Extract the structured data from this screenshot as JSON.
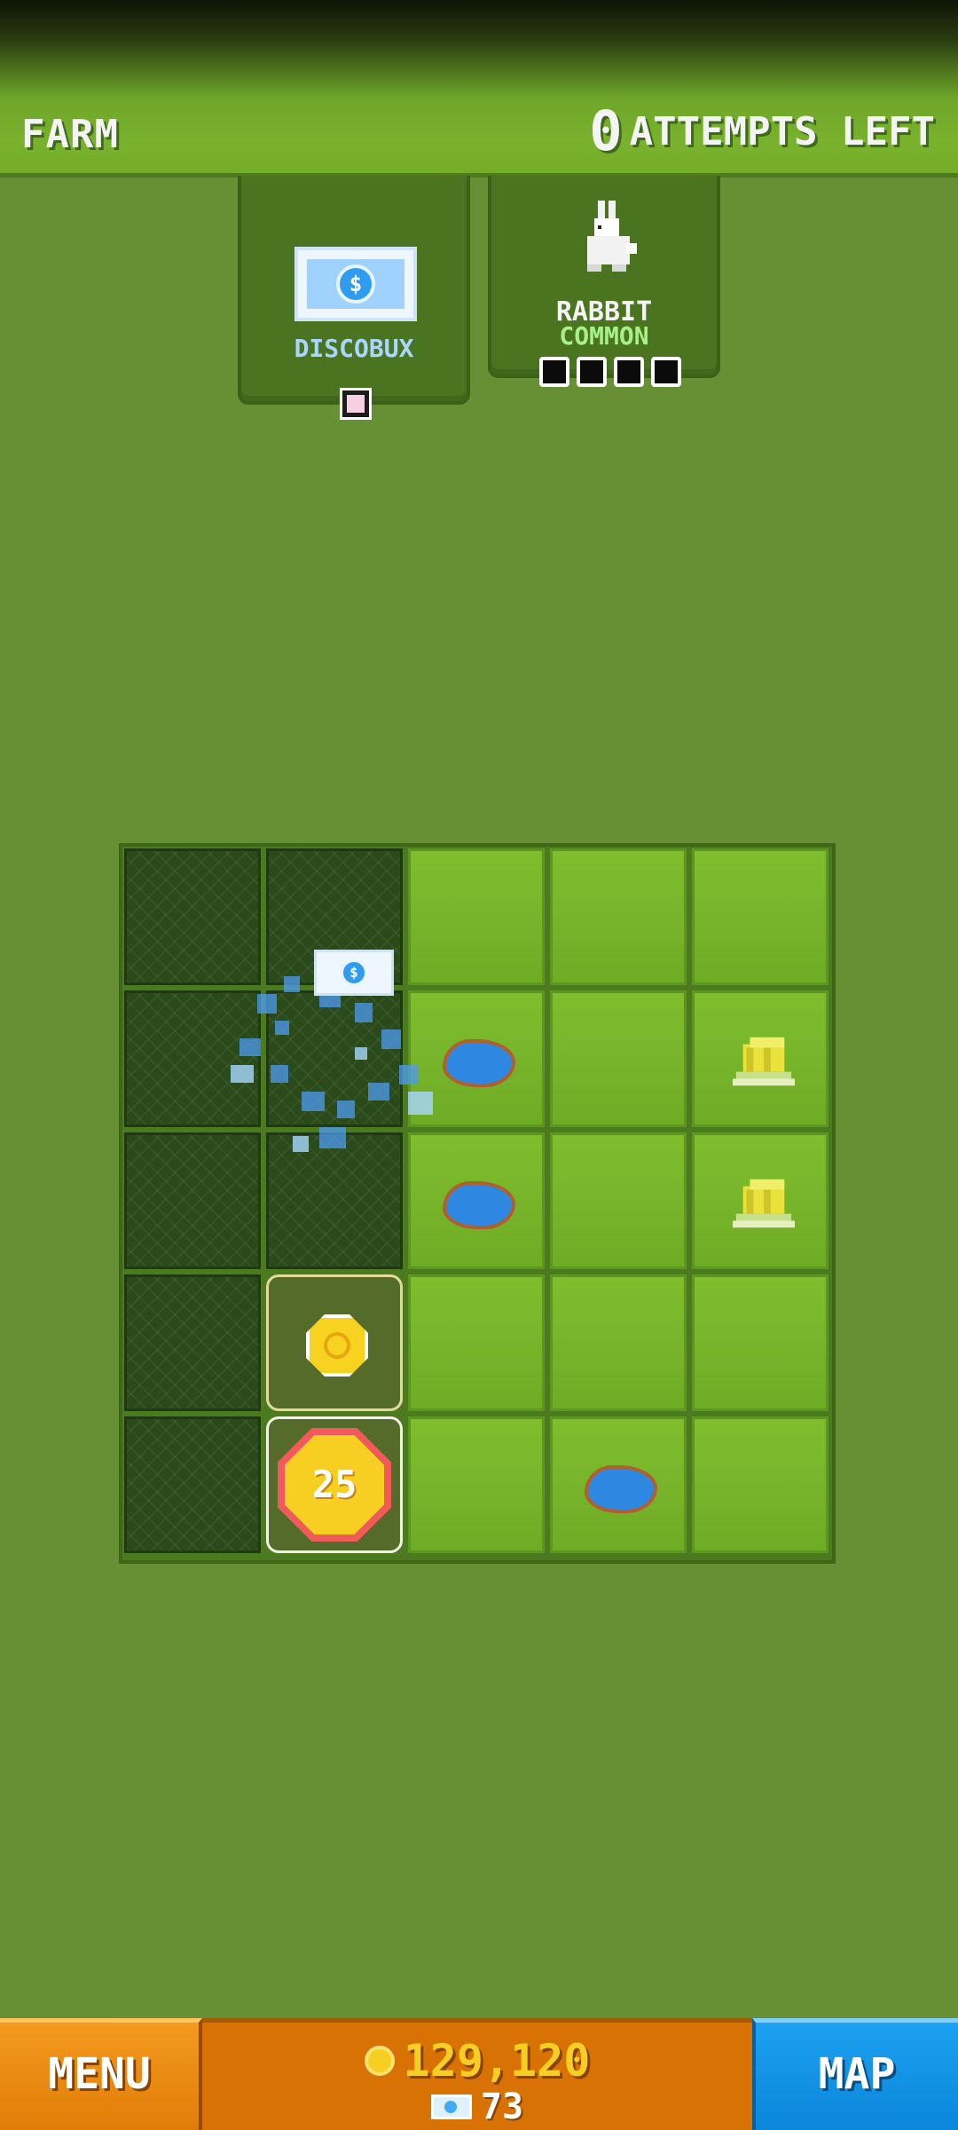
{
  "header": {
    "area_name": "FARM",
    "attempts_count": "0",
    "attempts_label": "ATTEMPTS LEFT"
  },
  "rewards": {
    "discobux": {
      "label": "DISCOBUX",
      "icon": "discobux-bill-icon"
    },
    "rabbit": {
      "name": "RABBIT",
      "rarity": "COMMON",
      "collected": 0,
      "total": 4,
      "icon": "rabbit-icon"
    }
  },
  "board": {
    "rows": 5,
    "cols": 5,
    "coin_value": "25",
    "cells": [
      [
        "dug",
        "dug",
        "grass",
        "grass",
        "grass"
      ],
      [
        "dug",
        "dug",
        "puddle",
        "grass",
        "hay"
      ],
      [
        "dug",
        "dug",
        "puddle",
        "grass",
        "hay"
      ],
      [
        "dug",
        "coin",
        "grass",
        "grass",
        "grass"
      ],
      [
        "dug",
        "coin-25",
        "grass",
        "puddle",
        "grass"
      ]
    ]
  },
  "footer": {
    "menu_label": "MENU",
    "coins": "129,120",
    "discobux": "73",
    "map_label": "MAP"
  },
  "colors": {
    "background": "#678f34",
    "grass": "#7fbd2e",
    "dug": "#2a4a1a",
    "menu": "#f49a1e",
    "map": "#1da1f0",
    "coin": "#f7cf22"
  }
}
